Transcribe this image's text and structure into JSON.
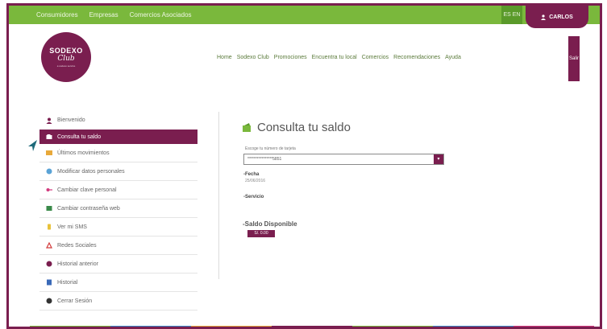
{
  "topbar": {
    "links": [
      "Consumidores",
      "Empresas",
      "Comercios Asociados"
    ],
    "lang": "ES EN",
    "user_label": "CARLOS"
  },
  "logo": {
    "line1": "SODEXO",
    "line2": "Club",
    "line3": "a sodexo service"
  },
  "mainnav": {
    "items": [
      "Home",
      "Sodexo Club",
      "Promociones",
      "Encuentra tu local",
      "Comercios",
      "Recomendaciones",
      "Ayuda"
    ],
    "exit_label": "Salir"
  },
  "sidebar": {
    "items": [
      {
        "label": "Bienvenido",
        "icon": "user-icon"
      },
      {
        "label": "Consulta tu saldo",
        "icon": "wallet-icon"
      },
      {
        "label": "Últimos movimientos",
        "icon": "list-icon"
      },
      {
        "label": "Modificar datos personales",
        "icon": "person-icon"
      },
      {
        "label": "Cambiar clave personal",
        "icon": "key-icon"
      },
      {
        "label": "Cambiar contraseña web",
        "icon": "lock-icon"
      },
      {
        "label": "Ver mi SMS",
        "icon": "phone-icon"
      },
      {
        "label": "Redes Sociales",
        "icon": "share-icon"
      },
      {
        "label": "Historial anterior",
        "icon": "history-icon"
      },
      {
        "label": "Historial",
        "icon": "document-icon"
      },
      {
        "label": "Cerrar Sesión",
        "icon": "power-icon"
      }
    ],
    "active_index": 1
  },
  "content": {
    "title": "Consulta tu saldo",
    "select_label": "Escoge tu número de tarjeta",
    "select_value": "****************5851",
    "fecha_label": "Fecha",
    "fecha_value": "25/06/2016",
    "servicio_label": "Servicio",
    "saldo_label": "Saldo Disponible",
    "saldo_value": "S/. 0.00"
  },
  "colors": {
    "brand": "#7a1e4f",
    "green": "#7ab83c"
  }
}
